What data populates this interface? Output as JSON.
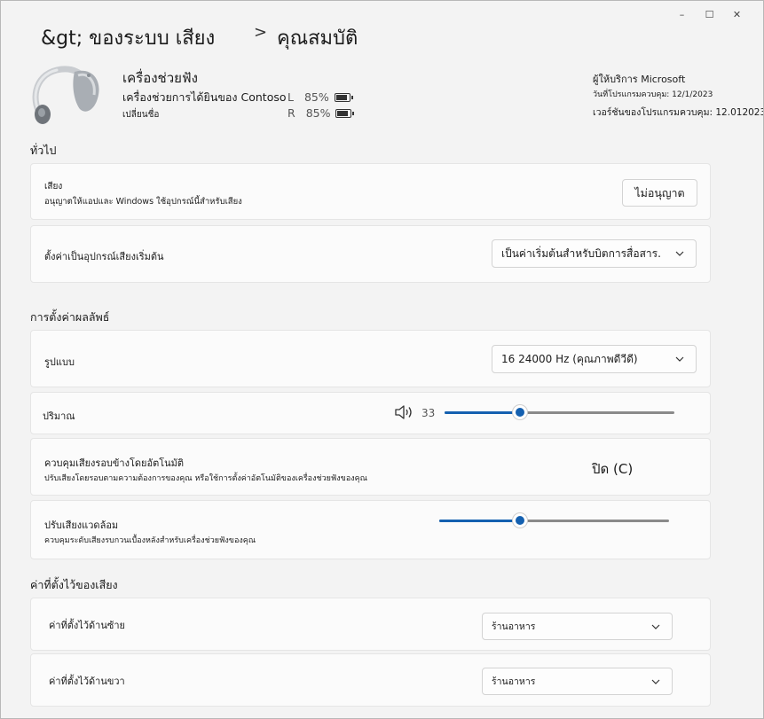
{
  "window": {
    "controls": [
      "–",
      "☐",
      "✕"
    ]
  },
  "breadcrumb": {
    "parent": "&gt; ของระบบ  เสียง",
    "separator": ">",
    "current": "คุณสมบัติ"
  },
  "device": {
    "name": "เครื่องช่วยฟัง",
    "description": "เครื่องช่วยการได้ยินของ Contoso",
    "rename_link": "เปลี่ยนชื่อ",
    "battery_left": {
      "label": "L",
      "value": "85%",
      "level": 0.85
    },
    "battery_right": {
      "label": "R",
      "value": "85%",
      "level": 0.85
    }
  },
  "info": {
    "provider": "ผู้ให้บริการ Microsoft",
    "driver_date": "วันที่โปรแกรมควบคุม: 12/1/2023",
    "driver_version": "เวอร์ชันของโปรแกรมควบคุม: 12.012023"
  },
  "general": {
    "title": "ทั่วไป",
    "audio": {
      "title": "เสียง",
      "subtitle": "อนุญาตให้แอปและ Windows ใช้อุปกรณ์นี้สำหรับเสียง",
      "button": "ไม่อนุญาต"
    },
    "default_device": {
      "title": "ตั้งค่าเป็นอุปกรณ์เสียงเริ่มต้น",
      "value": "เป็นค่าเริ่มต้นสำหรับบิตการสื่อสาร."
    }
  },
  "output": {
    "title": "การตั้งค่าผลลัพธ์",
    "format": {
      "title": "รูปแบบ",
      "value": "16 24000 Hz (คุณภาพดีวีดี)"
    },
    "volume": {
      "title": "ปริมาณ",
      "value": "33",
      "level": 0.33
    },
    "auto_ambient": {
      "title": "ควบคุมเสียงรอบข้างโดยอัตโนมัติ",
      "subtitle": "ปรับเสียงโดยรอบตามความต้องการของคุณ หรือใช้การตั้งค่าอัตโนมัติของเครื่องช่วยฟังของคุณ",
      "state": "ปิด (C)"
    },
    "ambient": {
      "title": "ปรับเสียงแวดล้อม",
      "subtitle": "ควบคุมระดับเสียงรบกวนเบื้องหลังสำหรับเครื่องช่วยฟังของคุณ",
      "level": 0.35
    }
  },
  "presets": {
    "title": "ค่าที่ตั้งไว้ของเสียง",
    "left": {
      "title": "ค่าที่ตั้งไว้ด้านซ้าย",
      "value": "ร้านอาหาร"
    },
    "right": {
      "title": "ค่าที่ตั้งไว้ด้านขวา",
      "value": "ร้านอาหาร"
    }
  }
}
